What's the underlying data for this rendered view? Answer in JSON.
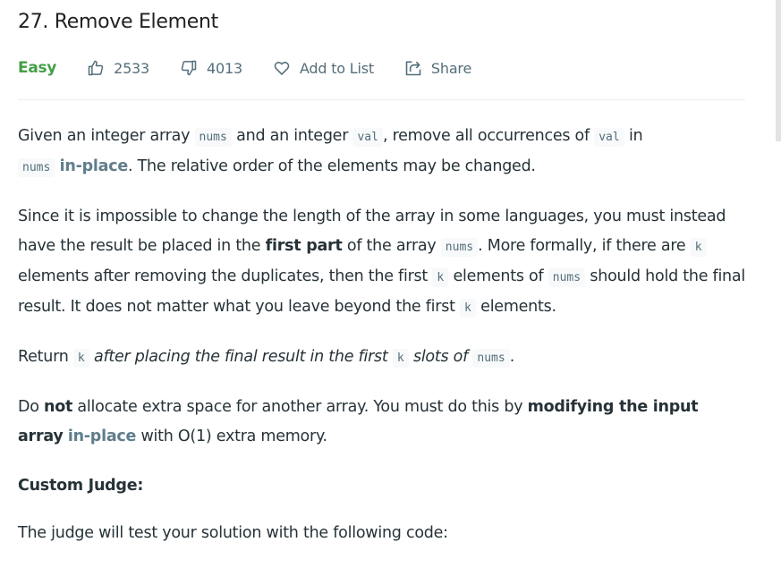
{
  "problem": {
    "title": "27. Remove Element",
    "difficulty": "Easy",
    "likes": "2533",
    "dislikes": "4013",
    "add_to_list_label": "Add to List",
    "share_label": "Share"
  },
  "colors": {
    "difficulty_easy": "#43a047",
    "meta_text": "#546e7a",
    "body_text": "#263238",
    "link_text": "#607d8b",
    "code_bg": "#f7f9fa"
  },
  "icons": {
    "like": "thumbs-up-icon",
    "dislike": "thumbs-down-icon",
    "add_to_list": "heart-icon",
    "share": "share-icon"
  },
  "description": {
    "p1": {
      "t1": "Given an integer array ",
      "c1": "nums",
      "t2": " and an integer ",
      "c2": "val",
      "t3": ", remove all occurrences of ",
      "c3": "val",
      "t4": " in ",
      "c4": "nums",
      "t5": " ",
      "link": "in-place",
      "t6": ". The relative order of the elements may be changed."
    },
    "p2": {
      "t1": "Since it is impossible to change the length of the array in some languages, you must instead have the result be placed in the ",
      "b1": "first part",
      "t2": " of the array ",
      "c1": "nums",
      "t3": ". More formally, if there are ",
      "c2": "k",
      "t4": " elements after removing the duplicates, then the first ",
      "c3": "k",
      "t5": " elements of ",
      "c4": "nums",
      "t6": " should hold the final result. It does not matter what you leave beyond the first ",
      "c5": "k",
      "t7": " elements."
    },
    "p3": {
      "t1": "Return ",
      "c1": "k",
      "i1": " after placing the final result in the first ",
      "c2": "k",
      "i2": " slots of ",
      "c3": "nums",
      "t2": "."
    },
    "p4": {
      "t1": "Do ",
      "b1": "not",
      "t2": " allocate extra space for another array. You must do this by ",
      "b2": "modifying the input array",
      "t3": " ",
      "link": "in-place",
      "t4": " with O(1) extra memory."
    },
    "custom_judge_heading": "Custom Judge:",
    "p5": "The judge will test your solution with the following code:"
  }
}
